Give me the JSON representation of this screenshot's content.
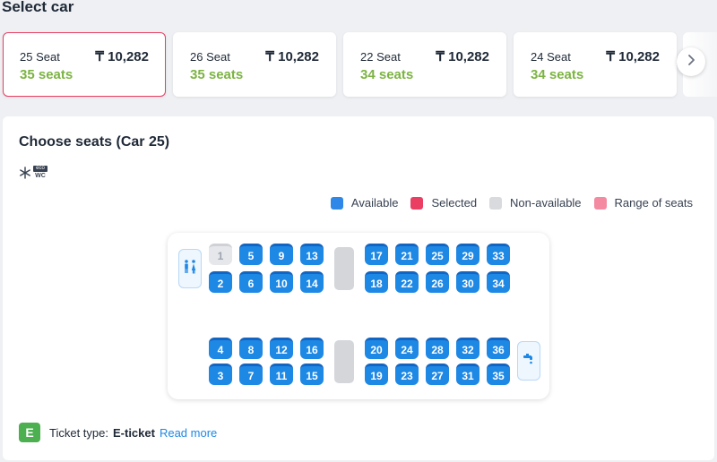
{
  "header": {
    "title": "Select car"
  },
  "cars": [
    {
      "name": "25 Seat",
      "price": "₸ 10,282",
      "seats": "35 seats",
      "selected": true
    },
    {
      "name": "26 Seat",
      "price": "₸ 10,282",
      "seats": "35 seats",
      "selected": false
    },
    {
      "name": "22 Seat",
      "price": "₸ 10,282",
      "seats": "34 seats",
      "selected": false
    },
    {
      "name": "24 Seat",
      "price": "₸ 10,282",
      "seats": "34 seats",
      "selected": false
    }
  ],
  "nav": {
    "next_icon": "chevron-right-icon"
  },
  "seat_panel": {
    "title": "Choose seats (Car 25)",
    "amenities": [
      "snowflake-icon",
      "eco-wc-icon"
    ],
    "amenity_text": {
      "eco": "eco",
      "wc": "WC"
    },
    "legend": [
      {
        "label": "Available",
        "color": "#2f88e8"
      },
      {
        "label": "Selected",
        "color": "#ea3e63"
      },
      {
        "label": "Non-available",
        "color": "#d9dadd"
      },
      {
        "label": "Range of seats",
        "color": "#f48aa2"
      }
    ]
  },
  "seats": {
    "unavailable": [
      "1"
    ],
    "upper_row_a": [
      "1",
      "5",
      "9",
      "13",
      "17",
      "21",
      "25",
      "29",
      "33"
    ],
    "upper_row_b": [
      "2",
      "6",
      "10",
      "14",
      "18",
      "22",
      "26",
      "30",
      "34"
    ],
    "lower_row_a": [
      "4",
      "8",
      "12",
      "16",
      "20",
      "24",
      "28",
      "32",
      "36"
    ],
    "lower_row_b": [
      "3",
      "7",
      "11",
      "15",
      "19",
      "23",
      "27",
      "31",
      "35"
    ]
  },
  "facilities": {
    "toilet_icon": "toilet-icon",
    "water_icon": "water-tap-icon"
  },
  "ticket": {
    "label": "Ticket type:",
    "type": "E-ticket",
    "link": "Read more",
    "badge": "E"
  }
}
